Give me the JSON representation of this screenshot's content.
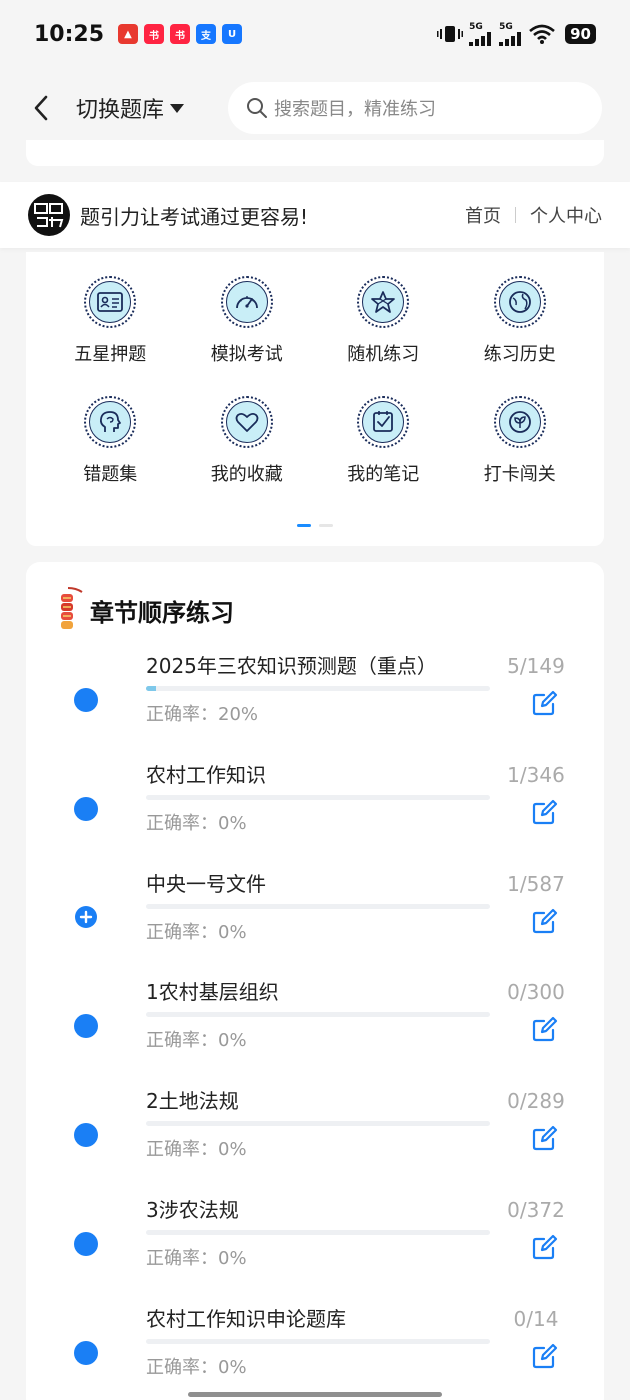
{
  "status_bar": {
    "time": "10:25",
    "signal1": "5G",
    "signal2": "5G",
    "battery": "90",
    "app_icons": [
      {
        "name": "red-app",
        "color": "#e8392f"
      },
      {
        "name": "xiaohongshu",
        "color": "#ff2442"
      },
      {
        "name": "xiaohongshu-2",
        "color": "#ff2442"
      },
      {
        "name": "alipay",
        "color": "#1677ff"
      },
      {
        "name": "shield-app",
        "color": "#1677ff"
      }
    ]
  },
  "nav": {
    "title": "切换题库",
    "search_placeholder": "搜索题目，精准练习"
  },
  "banner": {
    "slogan": "题引力让考试通过更容易!",
    "links": [
      "首页",
      "个人中心"
    ]
  },
  "grid": {
    "items": [
      {
        "label": "五星押题",
        "icon": "id-card-icon"
      },
      {
        "label": "模拟考试",
        "icon": "speedometer-icon"
      },
      {
        "label": "随机练习",
        "icon": "star-network-icon"
      },
      {
        "label": "练习历史",
        "icon": "globe-history-icon"
      },
      {
        "label": "错题集",
        "icon": "head-profile-icon"
      },
      {
        "label": "我的收藏",
        "icon": "heart-icon"
      },
      {
        "label": "我的笔记",
        "icon": "checked-note-icon"
      },
      {
        "label": "打卡闯关",
        "icon": "leaf-badge-icon"
      }
    ],
    "active_page": 0,
    "pages": 2
  },
  "chapters": {
    "title": "章节顺序练习",
    "accent_color": "#1a7ff5",
    "items": [
      {
        "title": "2025年三农知识预测题（重点）",
        "accuracy": "正确率：20%",
        "count": "5/149",
        "progress": 0.03,
        "expanded": false
      },
      {
        "title": "农村工作知识",
        "accuracy": "正确率：0%",
        "count": "1/346",
        "progress": 0.0,
        "expanded": false
      },
      {
        "title": "中央一号文件",
        "accuracy": "正确率：0%",
        "count": "1/587",
        "progress": 0.0,
        "expanded": true
      },
      {
        "title": "1农村基层组织",
        "accuracy": "正确率：0%",
        "count": "0/300",
        "progress": 0.0,
        "expanded": false
      },
      {
        "title": "2土地法规",
        "accuracy": "正确率：0%",
        "count": "0/289",
        "progress": 0.0,
        "expanded": false
      },
      {
        "title": "3涉农法规",
        "accuracy": "正确率：0%",
        "count": "0/372",
        "progress": 0.0,
        "expanded": false
      },
      {
        "title": "农村工作知识申论题库",
        "accuracy": "正确率：0%",
        "count": "0/14",
        "progress": 0.0,
        "expanded": false
      }
    ]
  }
}
